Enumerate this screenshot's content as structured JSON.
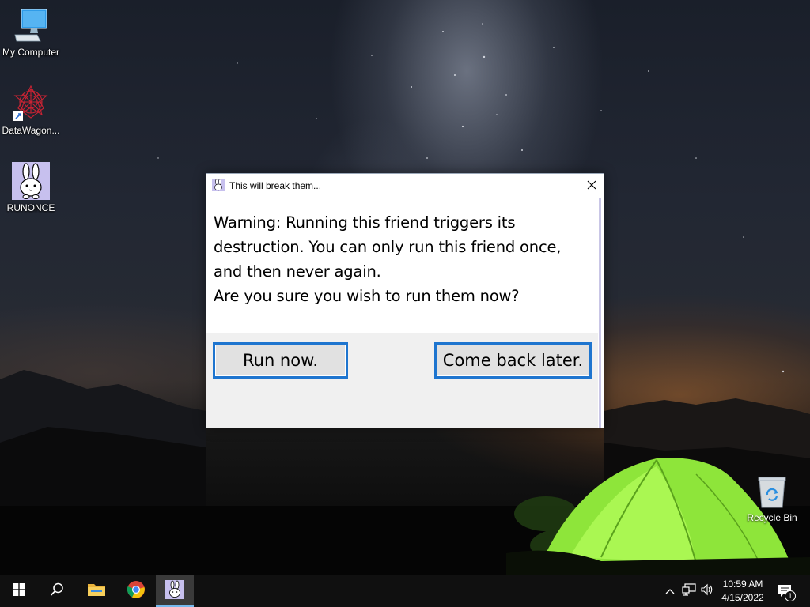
{
  "desktop": {
    "icons": [
      {
        "label": "My Computer",
        "icon": "computer-icon"
      },
      {
        "label": "DataWagon...",
        "icon": "datawagon-icon"
      },
      {
        "label": "RUNONCE",
        "icon": "bunny-icon"
      }
    ],
    "recycle_bin": {
      "label": "Recycle Bin",
      "icon": "recycle-bin-icon"
    }
  },
  "dialog": {
    "title": "This will break them...",
    "title_icon": "bunny-icon",
    "close_icon": "close-icon",
    "message_lines": [
      "Warning: Running this friend triggers its",
      "destruction. You can only run this friend once,",
      "and then never again.",
      "Are you sure you wish to run them now?"
    ],
    "run_button": "Run now.",
    "later_button": "Come back later."
  },
  "taskbar": {
    "start_icon": "windows-start-icon",
    "search_icon": "search-icon",
    "pinned": [
      "file-explorer-icon",
      "chrome-icon",
      "bunny-icon"
    ],
    "tray": {
      "icons": [
        "chevron-up-icon",
        "network-icon",
        "volume-icon"
      ],
      "time": "10:59 AM",
      "date": "4/15/2022",
      "notification_count": "1"
    }
  },
  "colors": {
    "dialog_button_border": "#1e75cf",
    "taskbar_bg": "#101010",
    "tent_green": "#8ee53a"
  }
}
